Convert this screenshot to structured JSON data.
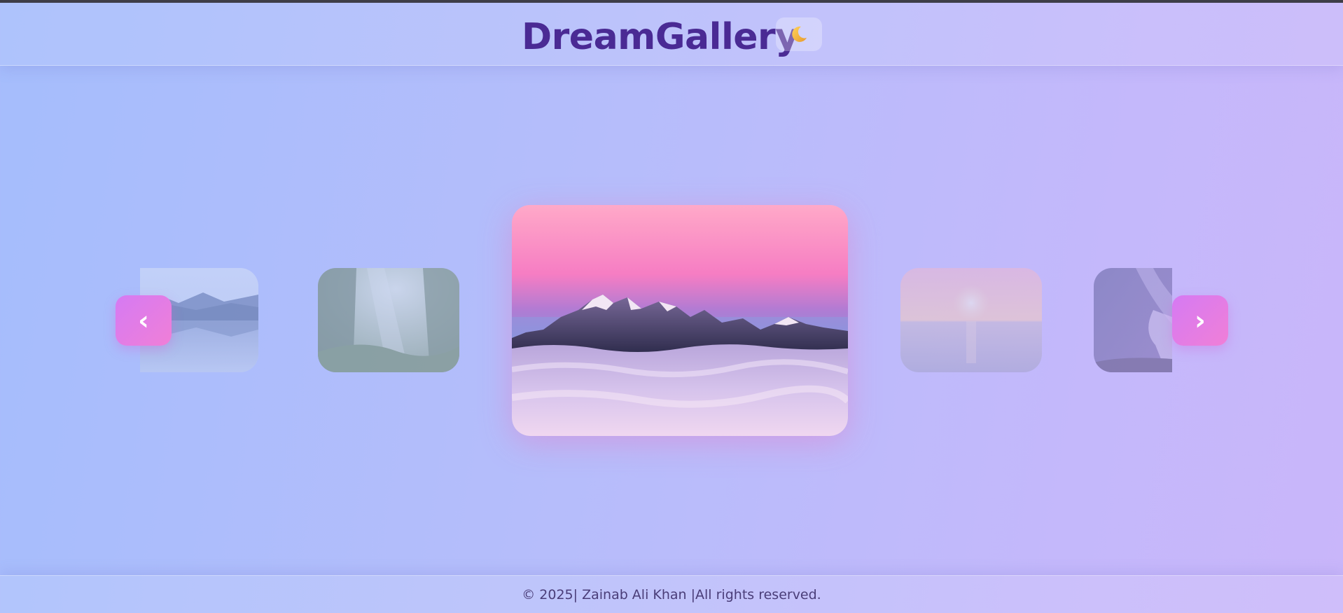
{
  "header": {
    "title": "DreamGallery",
    "theme_toggle_icon": "moon-icon"
  },
  "carousel": {
    "prev_label": "‹",
    "next_label": "›",
    "slides": [
      {
        "name": "lake-mountain-reflection",
        "position": "far-left"
      },
      {
        "name": "misty-forest",
        "position": "left"
      },
      {
        "name": "mountains-above-clouds",
        "position": "center"
      },
      {
        "name": "sea-sunset",
        "position": "right"
      },
      {
        "name": "milky-way-night",
        "position": "far-right"
      }
    ],
    "accent_color": "#e07ee6"
  },
  "footer": {
    "text": "© 2025| Zainab Ali Khan |All rights reserved."
  },
  "colors": {
    "title": "#4a2a94",
    "background_start": "#a5bdfc",
    "background_end": "#c9b6fa"
  }
}
